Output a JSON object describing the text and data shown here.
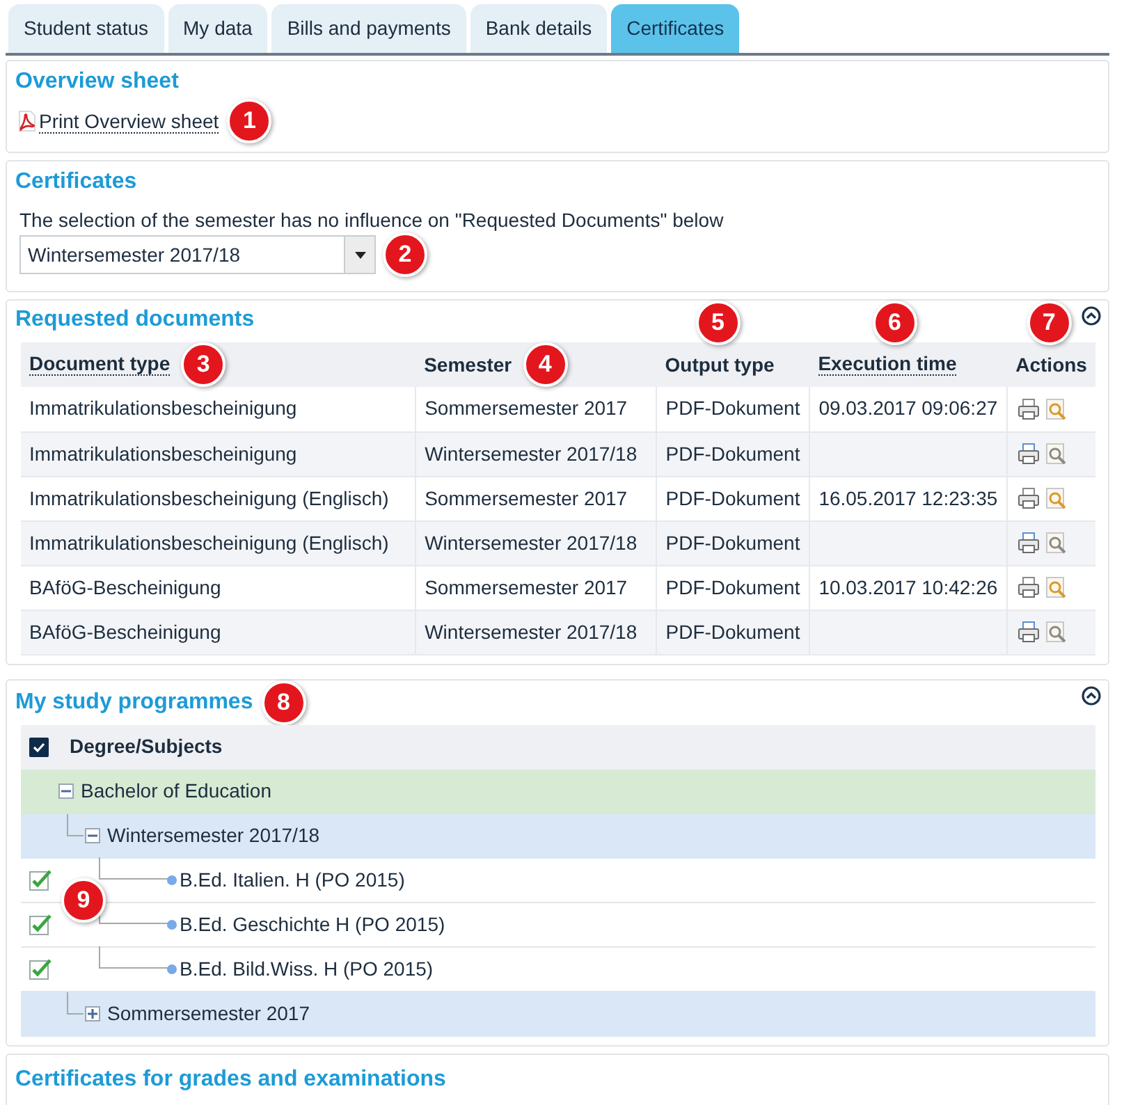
{
  "tabs": [
    {
      "label": "Student status",
      "selected": false
    },
    {
      "label": "My data",
      "selected": false
    },
    {
      "label": "Bills and payments",
      "selected": false
    },
    {
      "label": "Bank details",
      "selected": false
    },
    {
      "label": "Certificates",
      "selected": true
    }
  ],
  "overview": {
    "title": "Overview sheet",
    "link": "Print Overview sheet",
    "callout": "1"
  },
  "certificates": {
    "title": "Certificates",
    "note": "The selection of the semester has no influence on \"Requested Documents\" below",
    "semester_select": {
      "value": "Wintersemester 2017/18"
    },
    "callout": "2"
  },
  "requested_documents": {
    "title": "Requested documents",
    "expanded": true,
    "columns": [
      {
        "label": "Document type",
        "sortable": true,
        "callout": "3"
      },
      {
        "label": "Semester",
        "callout": "4"
      },
      {
        "label": "Output type",
        "callout": "5"
      },
      {
        "label": "Execution time",
        "sortable": true,
        "callout": "6"
      },
      {
        "label": "Actions",
        "callout": "7"
      }
    ],
    "rows": [
      {
        "document_type": "Immatrikulationsbescheinigung",
        "semester": "Sommersemester 2017",
        "output_type": "PDF-Dokument",
        "execution_time": "09.03.2017 09:06:27",
        "preview_available": true
      },
      {
        "document_type": "Immatrikulationsbescheinigung",
        "semester": "Wintersemester 2017/18",
        "output_type": "PDF-Dokument",
        "preview_available": false
      },
      {
        "document_type": "Immatrikulationsbescheinigung (Englisch)",
        "semester": "Sommersemester 2017",
        "output_type": "PDF-Dokument",
        "execution_time": "16.05.2017 12:23:35",
        "preview_available": true
      },
      {
        "document_type": "Immatrikulationsbescheinigung (Englisch)",
        "semester": "Wintersemester 2017/18",
        "output_type": "PDF-Dokument",
        "preview_available": false
      },
      {
        "document_type": "BAföG-Bescheinigung",
        "semester": "Sommersemester 2017",
        "output_type": "PDF-Dokument",
        "execution_time": "10.03.2017 10:42:26",
        "preview_available": true
      },
      {
        "document_type": "BAföG-Bescheinigung",
        "semester": "Wintersemester 2017/18",
        "output_type": "PDF-Dokument",
        "preview_available": false
      }
    ]
  },
  "study_programmes": {
    "title": "My study programmes",
    "callout": "8",
    "expanded": true,
    "header": {
      "label": "Degree/Subjects",
      "checked": true
    },
    "tree_callout": "9",
    "tree": [
      {
        "label": "Bachelor of Education",
        "kind": "degree",
        "expanded": true,
        "children": [
          {
            "label": "Wintersemester 2017/18",
            "kind": "semester",
            "expanded": true,
            "children": [
              {
                "label": "B.Ed. Italien. H (PO 2015)",
                "kind": "subject",
                "checked": true
              },
              {
                "label": "B.Ed. Geschichte H (PO 2015)",
                "kind": "subject",
                "checked": true
              },
              {
                "label": "B.Ed. Bild.Wiss. H (PO 2015)",
                "kind": "subject",
                "checked": true
              }
            ]
          },
          {
            "label": "Sommersemester 2017",
            "kind": "semester",
            "expanded": false
          }
        ]
      }
    ]
  },
  "grades_section": {
    "title": "Certificates for grades and examinations"
  }
}
